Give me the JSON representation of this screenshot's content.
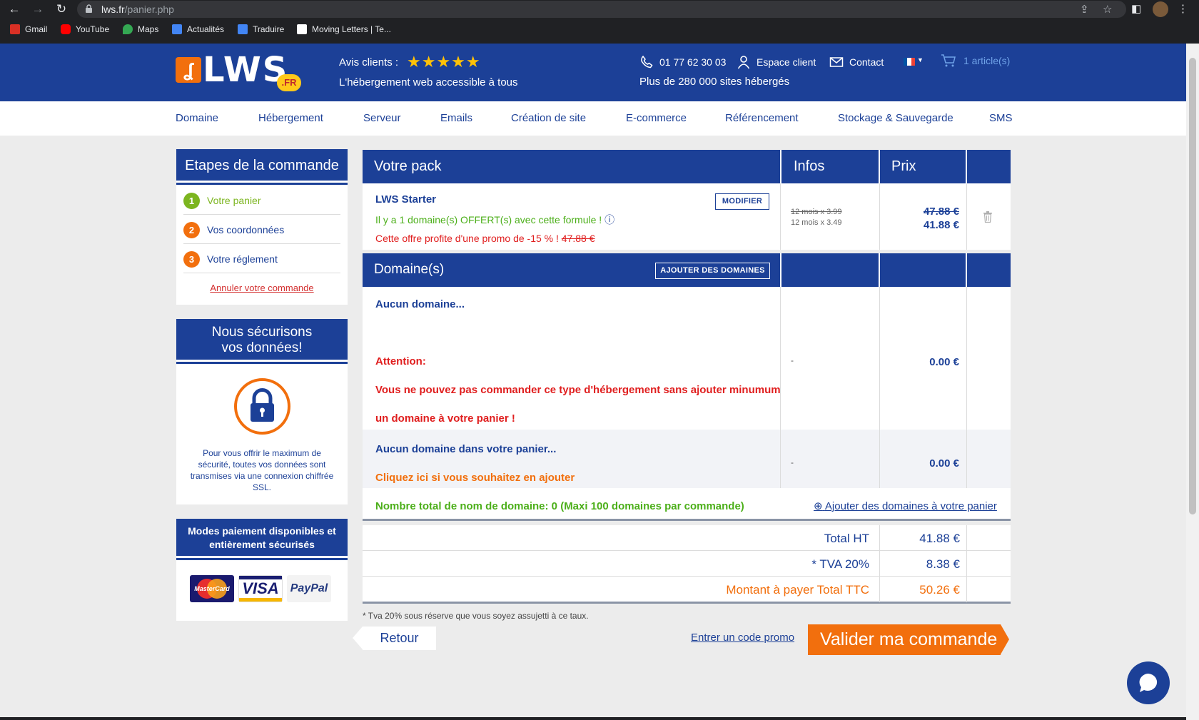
{
  "browser": {
    "url_domain": "lws.fr",
    "url_path": "/panier.php",
    "bookmarks": [
      "Gmail",
      "YouTube",
      "Maps",
      "Actualités",
      "Traduire",
      "Moving Letters | Te..."
    ]
  },
  "header": {
    "logo_text": "LWS",
    "logo_suffix": ".FR",
    "avis_label": "Avis clients :",
    "stars": "★★★★★",
    "rating": 4.5,
    "tagline": "L'hébergement web accessible à tous",
    "phone": "01 77 62 30 03",
    "espace_client": "Espace client",
    "contact": "Contact",
    "sites_hosted": "Plus de 280 000 sites hébergés",
    "cart_label": "1 article(s)"
  },
  "menu": [
    "Domaine",
    "Hébergement",
    "Serveur",
    "Emails",
    "Création de site",
    "E-commerce",
    "Référencement",
    "Stockage & Sauvegarde",
    "SMS"
  ],
  "sidebar": {
    "steps_title": "Etapes de la commande",
    "steps": [
      {
        "num": "1",
        "label": "Votre panier",
        "color": "#7cb51f"
      },
      {
        "num": "2",
        "label": "Vos coordonnées",
        "color": "#f26f0d"
      },
      {
        "num": "3",
        "label": "Votre réglement",
        "color": "#f26f0d"
      }
    ],
    "cancel": "Annuler votre commande",
    "security_title_1": "Nous sécurisons",
    "security_title_2": "vos données!",
    "security_text": "Pour vous offrir le maximum de sécurité, toutes vos données sont transmises via une connexion chiffrée SSL.",
    "payment_title": "Modes paiement disponibles et entièrement sécurisés",
    "cards": [
      "MasterCard",
      "VISA",
      "PayPal"
    ]
  },
  "cart": {
    "col_pack": "Votre pack",
    "col_infos": "Infos",
    "col_prix": "Prix",
    "product_name": "LWS Starter",
    "modifier": "MODIFIER",
    "offer_text": "Il y a 1 domaine(s) OFFERT(s) avec cette formule !",
    "promo_text": "Cette offre profite d'une promo de -15 % !",
    "promo_old": "47.88 €",
    "info_old": "12 mois x 3.99",
    "info_new": "12 mois x 3.49",
    "price_old": "47.88 €",
    "price_new": "41.88 €",
    "domains_title": "Domaine(s)",
    "add_domains_btn": "AJOUTER DES DOMAINES",
    "no_domain": "Aucun domaine...",
    "attention": "Attention:",
    "warning_1": "Vous ne pouvez pas commander ce type d'hébergement sans ajouter minumum",
    "warning_2": "un domaine à votre panier !",
    "dash": "-",
    "zero_price": "0.00 €",
    "no_domain_cart": "Aucun domaine dans votre panier...",
    "click_add": "Cliquez ici si vous souhaitez en ajouter",
    "total_domains": "Nombre total de nom de domaine: 0 (Maxi 100 domaines par commande)",
    "add_domains_link": "Ajouter des domaines à votre panier"
  },
  "totals": {
    "ht_label": "Total HT",
    "ht_value": "41.88 €",
    "tva_label": "* TVA 20%",
    "tva_value": "8.38 €",
    "ttc_label": "Montant à payer Total TTC",
    "ttc_value": "50.26 €",
    "footnote": "* Tva 20% sous réserve que vous soyez assujetti à ce taux."
  },
  "actions": {
    "retour": "Retour",
    "promo_code": "Entrer un code promo",
    "valider": "Valider ma commande"
  },
  "colors": {
    "brand_blue": "#1c4097",
    "brand_orange": "#f26f0d",
    "green": "#4caf1a",
    "red": "#e01e1e"
  }
}
